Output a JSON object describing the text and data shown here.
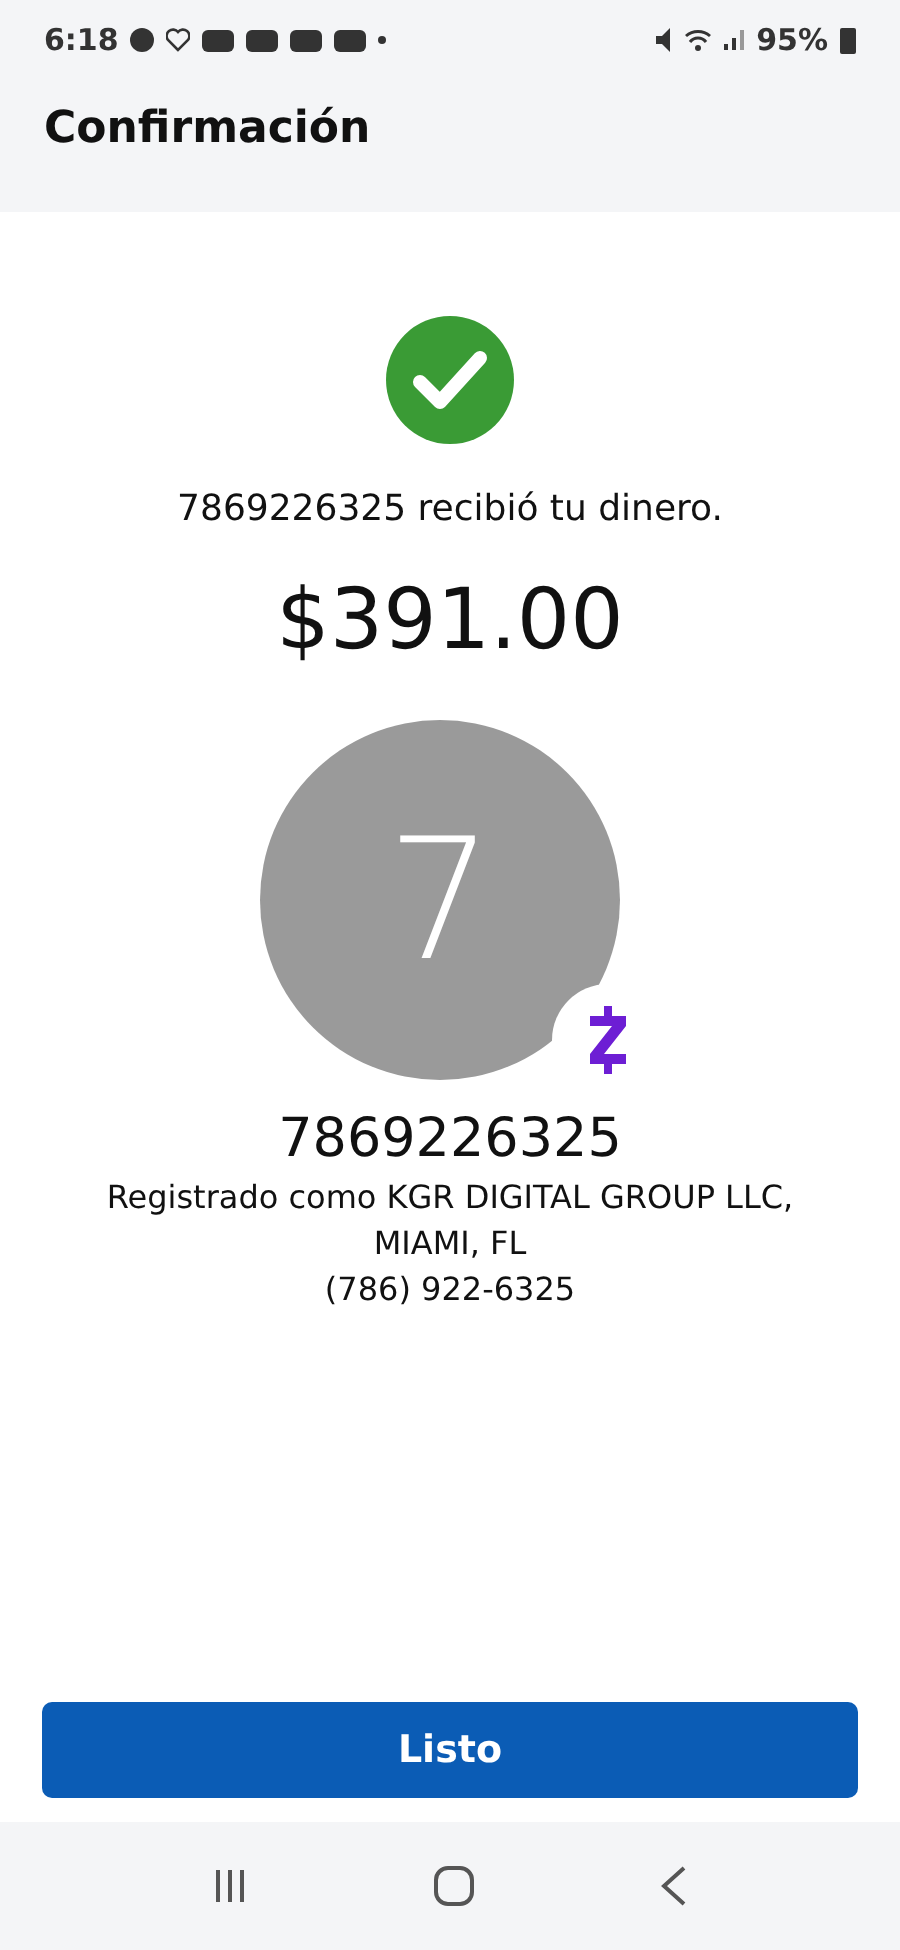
{
  "status_bar": {
    "time": "6:18",
    "battery": "95%"
  },
  "header": {
    "title": "Confirmación"
  },
  "confirmation": {
    "message": "7869226325 recibió tu dinero.",
    "amount": "$391.00"
  },
  "recipient": {
    "initial": "7",
    "name": "7869226325",
    "details": [
      "Registrado como KGR DIGITAL GROUP LLC,",
      "MIAMI, FL",
      "(786) 922-6325"
    ]
  },
  "button": {
    "label": "Listo"
  }
}
